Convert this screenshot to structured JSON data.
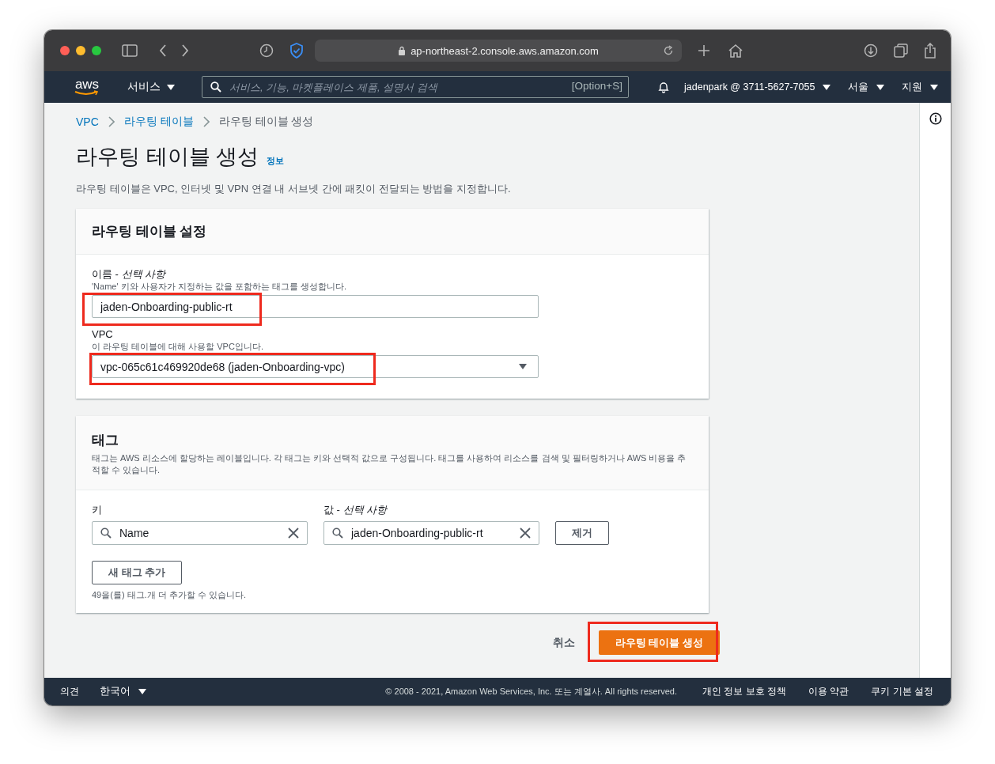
{
  "browser": {
    "url": "ap-northeast-2.console.aws.amazon.com"
  },
  "aws_nav": {
    "logo": "aws",
    "services_menu": "서비스",
    "search": {
      "placeholder": "서비스, 기능, 마켓플레이스 제품, 설명서 검색",
      "shortcut": "[Option+S]"
    },
    "account": "jadenpark @ 3711-5627-7055",
    "region": "서울",
    "support": "지원"
  },
  "breadcrumbs": [
    {
      "label": "VPC",
      "link": true
    },
    {
      "label": "라우팅 테이블",
      "link": true
    },
    {
      "label": "라우팅 테이블 생성",
      "link": false
    }
  ],
  "page": {
    "title": "라우팅 테이블 생성",
    "info_link": "정보",
    "description": "라우팅 테이블은 VPC, 인터넷 및 VPN 연결 내 서브넷 간에 패킷이 전달되는 방법을 지정합니다."
  },
  "settings_panel": {
    "title": "라우팅 테이블 설정",
    "fields": [
      {
        "kind": "text",
        "label": "이름 - *선택 사항*",
        "hint": "'Name' 키와 사용자가 지정하는 값을 포함하는 태그를 생성합니다.",
        "value": "jaden-Onboarding-public-rt",
        "highlighted": true
      },
      {
        "kind": "select",
        "label": "VPC",
        "hint": "이 라우팅 테이블에 대해 사용할 VPC입니다.",
        "value": "vpc-065c61c469920de68 (jaden-Onboarding-vpc)",
        "highlighted": true
      }
    ]
  },
  "tags_panel": {
    "title": "태그",
    "description": "태그는 AWS 리소스에 할당하는 레이블입니다. 각 태그는 키와 선택적 값으로 구성됩니다. 태그를 사용하여 리소스를 검색 및 필터링하거나 AWS 비용을 추적할 수 있습니다.",
    "key_label": "키",
    "value_label": "값 - *선택 사항*",
    "tags": [
      {
        "key": "Name",
        "value": "jaden-Onboarding-public-rt",
        "remove_button": "제거"
      }
    ],
    "add_button": "새 태그 추가",
    "limit_note": "49을(를) 태그.개 더 추가할 수 있습니다."
  },
  "actions": {
    "cancel": "취소",
    "submit": {
      "label": "라우팅 테이블 생성",
      "highlighted": true
    }
  },
  "footer": {
    "feedback": "의견",
    "language": "한국어",
    "copyright": "© 2008 - 2021, Amazon Web Services, Inc. 또는 계열사. All rights reserved.",
    "links": [
      "개인 정보 보호 정책",
      "이용 약관",
      "쿠키 기본 설정"
    ]
  }
}
